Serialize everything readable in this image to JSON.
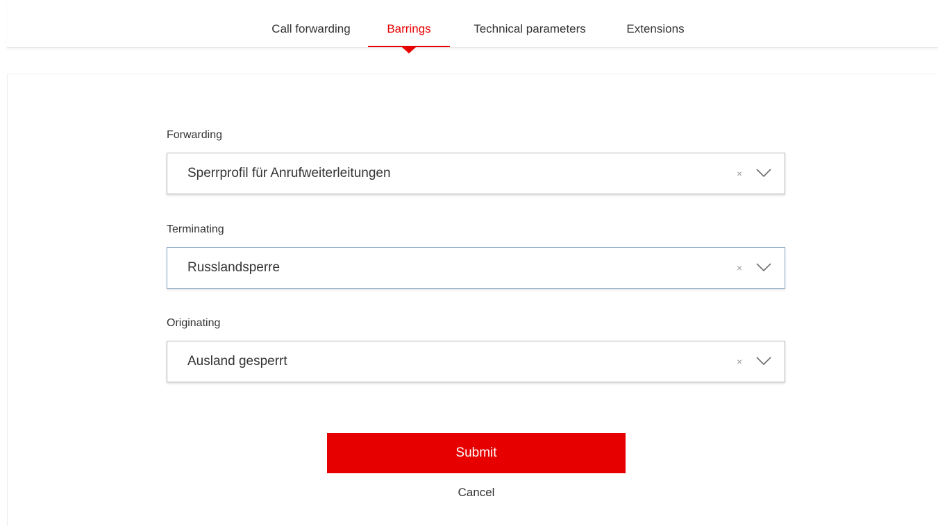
{
  "tabs": [
    {
      "label": "Call forwarding",
      "active": false
    },
    {
      "label": "Barrings",
      "active": true
    },
    {
      "label": "Technical parameters",
      "active": false
    },
    {
      "label": "Extensions",
      "active": false
    }
  ],
  "form": {
    "forwarding": {
      "label": "Forwarding",
      "value": "Sperrprofil für Anrufweiterleitungen"
    },
    "terminating": {
      "label": "Terminating",
      "value": "Russlandsperre"
    },
    "originating": {
      "label": "Originating",
      "value": "Ausland gesperrt"
    },
    "clear_symbol": "×"
  },
  "actions": {
    "submit_label": "Submit",
    "cancel_label": "Cancel"
  },
  "colors": {
    "accent": "#e60000",
    "text": "#333333",
    "border": "#b5b5b5"
  },
  "icons": {
    "clear": "close-icon",
    "dropdown": "chevron-down-icon"
  }
}
